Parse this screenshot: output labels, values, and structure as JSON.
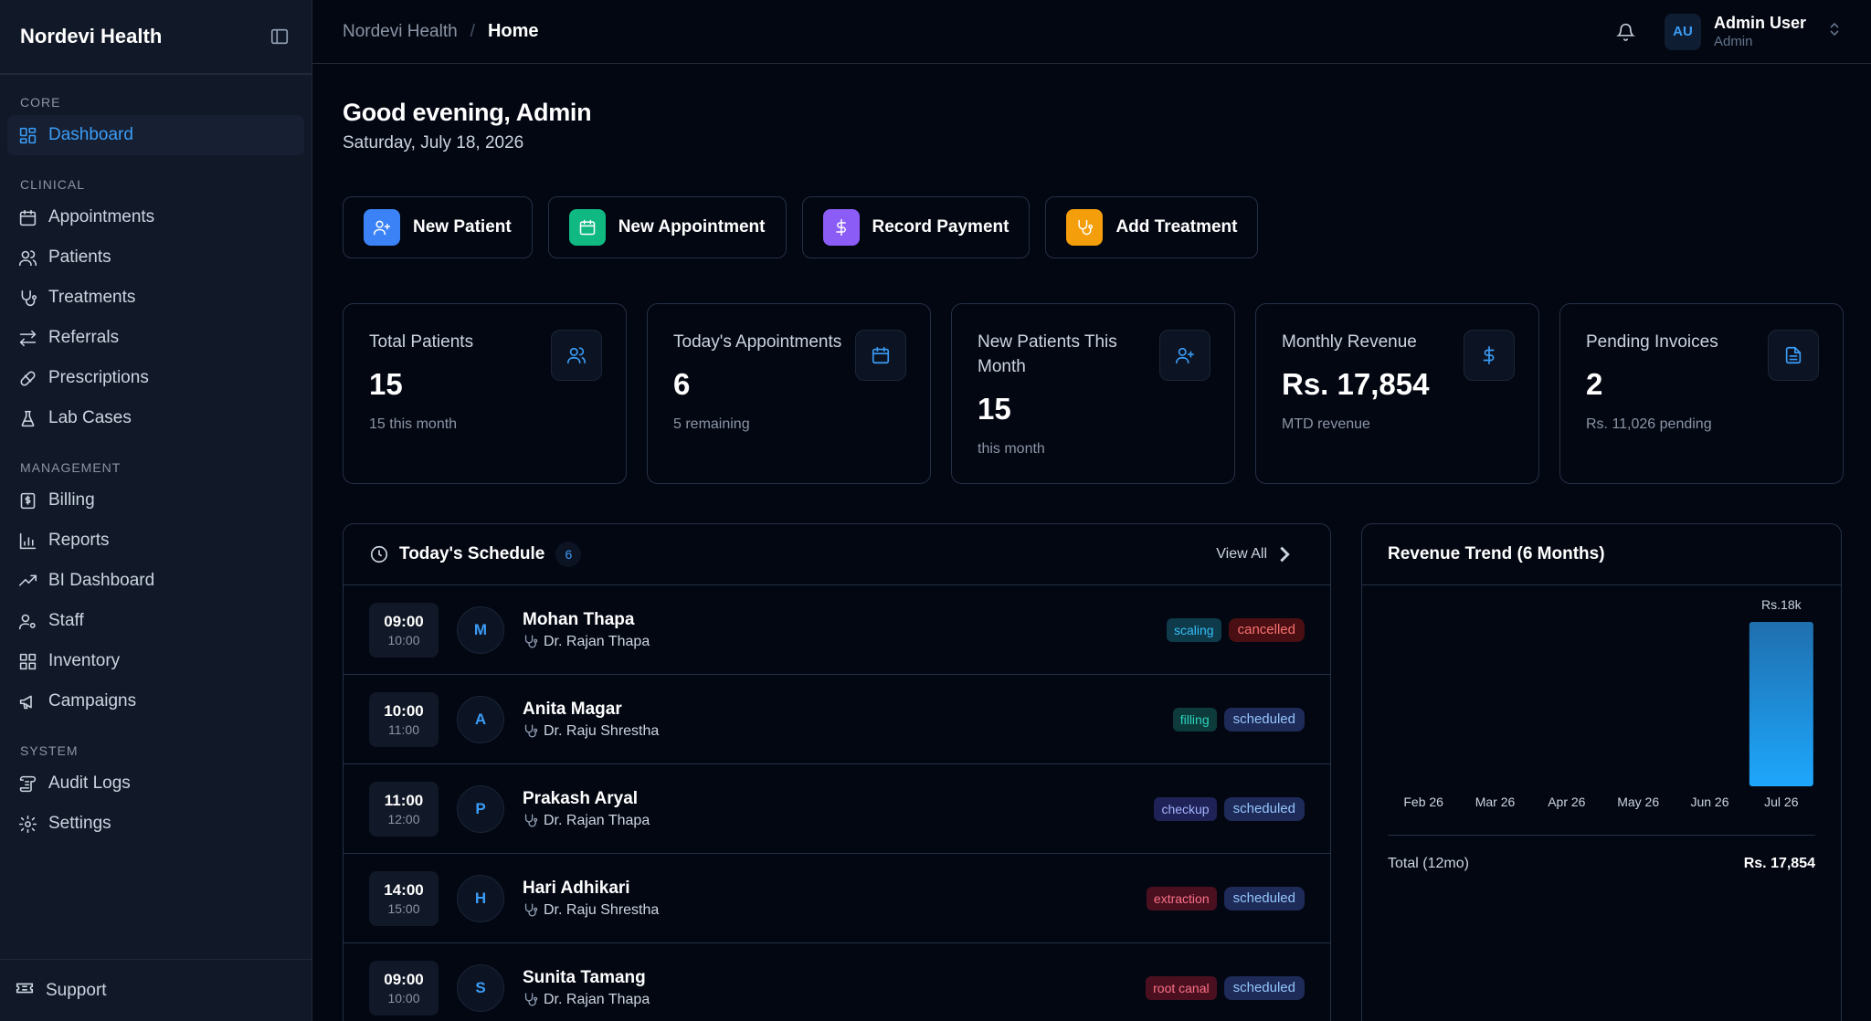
{
  "app": {
    "brand": "Nordevi Health"
  },
  "sidebar": {
    "sections": [
      {
        "title": "CORE",
        "items": [
          {
            "label": "Dashboard",
            "icon": "dashboard-icon",
            "active": true
          }
        ]
      },
      {
        "title": "CLINICAL",
        "items": [
          {
            "label": "Appointments",
            "icon": "calendar-icon"
          },
          {
            "label": "Patients",
            "icon": "users-icon"
          },
          {
            "label": "Treatments",
            "icon": "stethoscope-icon"
          },
          {
            "label": "Referrals",
            "icon": "arrows-exchange-icon"
          },
          {
            "label": "Prescriptions",
            "icon": "pill-icon"
          },
          {
            "label": "Lab Cases",
            "icon": "flask-icon"
          }
        ]
      },
      {
        "title": "MANAGEMENT",
        "items": [
          {
            "label": "Billing",
            "icon": "receipt-icon"
          },
          {
            "label": "Reports",
            "icon": "bar-chart-icon"
          },
          {
            "label": "BI Dashboard",
            "icon": "trending-up-icon"
          },
          {
            "label": "Staff",
            "icon": "user-cog-icon"
          },
          {
            "label": "Inventory",
            "icon": "grid-icon"
          },
          {
            "label": "Campaigns",
            "icon": "megaphone-icon"
          }
        ]
      },
      {
        "title": "SYSTEM",
        "items": [
          {
            "label": "Audit Logs",
            "icon": "scroll-icon"
          },
          {
            "label": "Settings",
            "icon": "gear-icon"
          }
        ]
      }
    ],
    "support_label": "Support"
  },
  "topbar": {
    "breadcrumb_root": "Nordevi Health",
    "breadcrumb_sep": "/",
    "breadcrumb_current": "Home",
    "user": {
      "initials": "AU",
      "name": "Admin User",
      "role": "Admin"
    }
  },
  "greeting": {
    "title": "Good evening, Admin",
    "date": "Saturday, July 18, 2026"
  },
  "quick_actions": [
    {
      "label": "New Patient",
      "icon": "user-plus-icon",
      "color": "#3b82f6"
    },
    {
      "label": "New Appointment",
      "icon": "calendar-icon",
      "color": "#10b981"
    },
    {
      "label": "Record Payment",
      "icon": "dollar-icon",
      "color": "#8b5cf6"
    },
    {
      "label": "Add Treatment",
      "icon": "stethoscope-icon",
      "color": "#f59e0b"
    }
  ],
  "stats": [
    {
      "label": "Total Patients",
      "value": "15",
      "sub": "15 this month",
      "icon": "users-icon"
    },
    {
      "label": "Today's Appointments",
      "value": "6",
      "sub": "5 remaining",
      "icon": "calendar-icon"
    },
    {
      "label": "New Patients This Month",
      "value": "15",
      "sub": "this month",
      "icon": "user-plus-icon"
    },
    {
      "label": "Monthly Revenue",
      "value": "Rs. 17,854",
      "sub": "MTD revenue",
      "icon": "dollar-icon"
    },
    {
      "label": "Pending Invoices",
      "value": "2",
      "sub": "Rs. 11,026 pending",
      "icon": "file-text-icon"
    }
  ],
  "schedule": {
    "title": "Today's Schedule",
    "count": "6",
    "view_all": "View All",
    "rows": [
      {
        "start": "09:00",
        "end": "10:00",
        "initial": "M",
        "patient": "Mohan Thapa",
        "doctor": "Dr. Rajan Thapa",
        "type": "scaling",
        "status": "cancelled"
      },
      {
        "start": "10:00",
        "end": "11:00",
        "initial": "A",
        "patient": "Anita Magar",
        "doctor": "Dr. Raju Shrestha",
        "type": "filling",
        "status": "scheduled"
      },
      {
        "start": "11:00",
        "end": "12:00",
        "initial": "P",
        "patient": "Prakash Aryal",
        "doctor": "Dr. Rajan Thapa",
        "type": "checkup",
        "status": "scheduled"
      },
      {
        "start": "14:00",
        "end": "15:00",
        "initial": "H",
        "patient": "Hari Adhikari",
        "doctor": "Dr. Raju Shrestha",
        "type": "extraction",
        "status": "scheduled"
      },
      {
        "start": "09:00",
        "end": "10:00",
        "initial": "S",
        "patient": "Sunita Tamang",
        "doctor": "Dr. Rajan Thapa",
        "type": "root canal",
        "status": "scheduled"
      }
    ]
  },
  "tag_colors": {
    "scaling": {
      "bg": "#0e3a4a",
      "fg": "#38bdf8"
    },
    "filling": {
      "bg": "#0d3b3b",
      "fg": "#2dd4bf"
    },
    "checkup": {
      "bg": "#1e2257",
      "fg": "#a5b4fc"
    },
    "extraction": {
      "bg": "#4a1020",
      "fg": "#fb7185"
    },
    "root canal": {
      "bg": "#4a1020",
      "fg": "#fb7185"
    },
    "cancelled": {
      "bg": "#4a0f12",
      "fg": "#f87171"
    },
    "scheduled": {
      "bg": "#1e2a57",
      "fg": "#93c5fd"
    }
  },
  "revenue": {
    "title": "Revenue Trend (6 Months)",
    "total_label": "Total (12mo)",
    "total_value": "Rs. 17,854"
  },
  "chart_data": {
    "type": "bar",
    "categories": [
      "Feb 26",
      "Mar 26",
      "Apr 26",
      "May 26",
      "Jun 26",
      "Jul 26"
    ],
    "values": [
      0,
      0,
      0,
      0,
      0,
      17854
    ],
    "data_labels": [
      "",
      "",
      "",
      "",
      "",
      "Rs.18k"
    ],
    "ylim": [
      0,
      17854
    ],
    "grid": false,
    "bar_color_top": "#1f6fae",
    "bar_color_bottom": "#1ea7fd"
  }
}
